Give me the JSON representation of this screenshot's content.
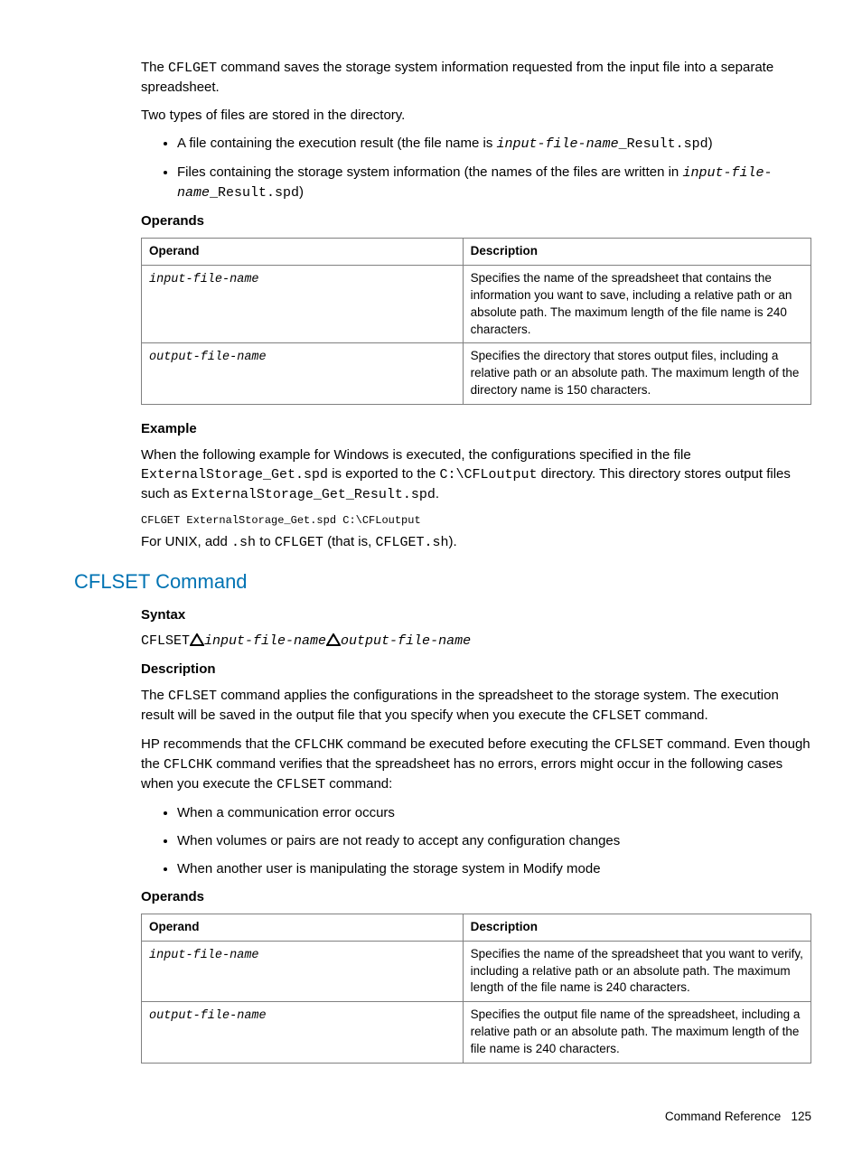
{
  "intro": {
    "p1a": "The ",
    "p1b": "CFLGET",
    "p1c": " command saves the storage system information requested from the input file into a separate spreadsheet.",
    "p2": "Two types of files are stored in the directory.",
    "li1a": "A file containing the execution result (the file name is ",
    "li1b": "input-file-name",
    "li1c": "_Result.spd",
    "li1d": ")",
    "li2a": "Files containing the storage system information (the names of the files are written in ",
    "li2b": "input-file-name",
    "li2c": "_Result.spd",
    "li2d": ")"
  },
  "operands1": {
    "heading": "Operands",
    "col1": "Operand",
    "col2": "Description",
    "row1op": "input-file-name",
    "row1desc": "Specifies the name of the spreadsheet that contains the information you want to save, including a relative path or an absolute path. The maximum length of the file name is 240 characters.",
    "row2op": "output-file-name",
    "row2desc": "Specifies the directory that stores output files, including a relative path or an absolute path. The maximum length of the directory name is 150 characters."
  },
  "example1": {
    "heading": "Example",
    "p1a": "When the following example for Windows is executed, the configurations specified in the file ",
    "p1b": "ExternalStorage_Get.spd",
    "p1c": " is exported to the ",
    "p1d": "C:\\CFLoutput",
    "p1e": " directory. This directory stores output files such as ",
    "p1f": "ExternalStorage_Get_Result.spd",
    "p1g": ".",
    "code": "CFLGET ExternalStorage_Get.spd C:\\CFLoutput",
    "p2a": "For UNIX, add ",
    "p2b": ".sh",
    "p2c": " to ",
    "p2d": "CFLGET",
    "p2e": " (that is, ",
    "p2f": "CFLGET.sh",
    "p2g": ")."
  },
  "cflset": {
    "title": "CFLSET Command",
    "syntax_heading": "Syntax",
    "syn_cmd": "CFLSET",
    "syn_arg1": "input-file-name",
    "syn_arg2": "output-file-name",
    "desc_heading": "Description",
    "d1a": "The ",
    "d1b": "CFLSET",
    "d1c": " command applies the configurations in the spreadsheet to the storage system. The execution result will be saved in the output file that you specify when you execute the ",
    "d1d": "CFLSET",
    "d1e": " command.",
    "d2a": "HP recommends that the ",
    "d2b": "CFLCHK",
    "d2c": " command be executed before executing the ",
    "d2d": "CFLSET",
    "d2e": " command. Even though the ",
    "d2f": "CFLCHK",
    "d2g": " command verifies that the spreadsheet has no errors, errors might occur in the following cases when you execute the ",
    "d2h": "CFLSET",
    "d2i": " command:",
    "li1": "When a communication error occurs",
    "li2": "When volumes or pairs are not ready to accept any configuration changes",
    "li3": "When another user is manipulating the storage system in Modify mode"
  },
  "operands2": {
    "heading": "Operands",
    "col1": "Operand",
    "col2": "Description",
    "row1op": "input-file-name",
    "row1desc": "Specifies the name of the spreadsheet that you want to verify, including a relative path or an absolute path. The maximum length of the file name is 240 characters.",
    "row2op": "output-file-name",
    "row2desc": "Specifies the output file name of the spreadsheet, including a relative path or an absolute path. The maximum length of the file name is 240 characters."
  },
  "footer": {
    "label": "Command Reference",
    "page": "125"
  }
}
